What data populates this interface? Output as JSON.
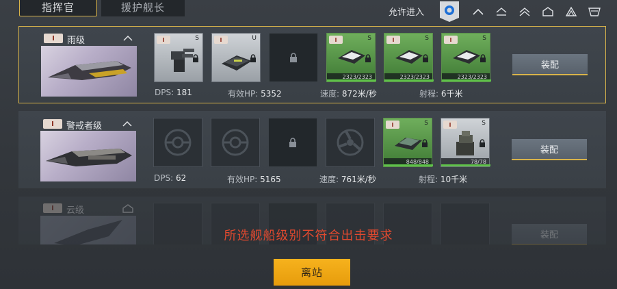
{
  "tabs": {
    "commander": "指挥官",
    "escort": "援护舰长"
  },
  "filter": {
    "allow_label": "允许进入",
    "icons": [
      "class-frigate-icon",
      "class-destroyer-icon",
      "class-cruiser-icon",
      "class-battlecruiser-icon",
      "class-battleship-icon",
      "class-carrier-icon"
    ]
  },
  "ships": [
    {
      "tier": "I",
      "name": "雨级",
      "stats": {
        "dps_label": "DPS:",
        "dps": "181",
        "hp_label": "有效HP:",
        "hp": "5352",
        "speed_label": "速度:",
        "speed": "872米/秒",
        "range_label": "射程:",
        "range": "6千米"
      },
      "equip_label": "装配",
      "slots": [
        {
          "grade": "S",
          "hp": ""
        },
        {
          "grade": "U",
          "hp": ""
        },
        {
          "grade": "",
          "hp": ""
        },
        {
          "grade": "S",
          "hp": "2323/2323"
        },
        {
          "grade": "S",
          "hp": "2323/2323"
        },
        {
          "grade": "S",
          "hp": "2323/2323"
        }
      ]
    },
    {
      "tier": "I",
      "name": "警戒者级",
      "stats": {
        "dps_label": "DPS:",
        "dps": "62",
        "hp_label": "有效HP:",
        "hp": "5165",
        "speed_label": "速度:",
        "speed": "761米/秒",
        "range_label": "射程:",
        "range": "10千米"
      },
      "equip_label": "装配",
      "slots": [
        {
          "grade": "",
          "hp": ""
        },
        {
          "grade": "",
          "hp": ""
        },
        {
          "grade": "",
          "hp": ""
        },
        {
          "grade": "",
          "hp": ""
        },
        {
          "grade": "S",
          "hp": "848/848"
        },
        {
          "grade": "S",
          "hp": "78/78"
        }
      ]
    },
    {
      "tier": "I",
      "name": "云级",
      "equip_label": "装配"
    }
  ],
  "warning": "所选舰船级别不符合出击要求",
  "leave_label": "离站"
}
